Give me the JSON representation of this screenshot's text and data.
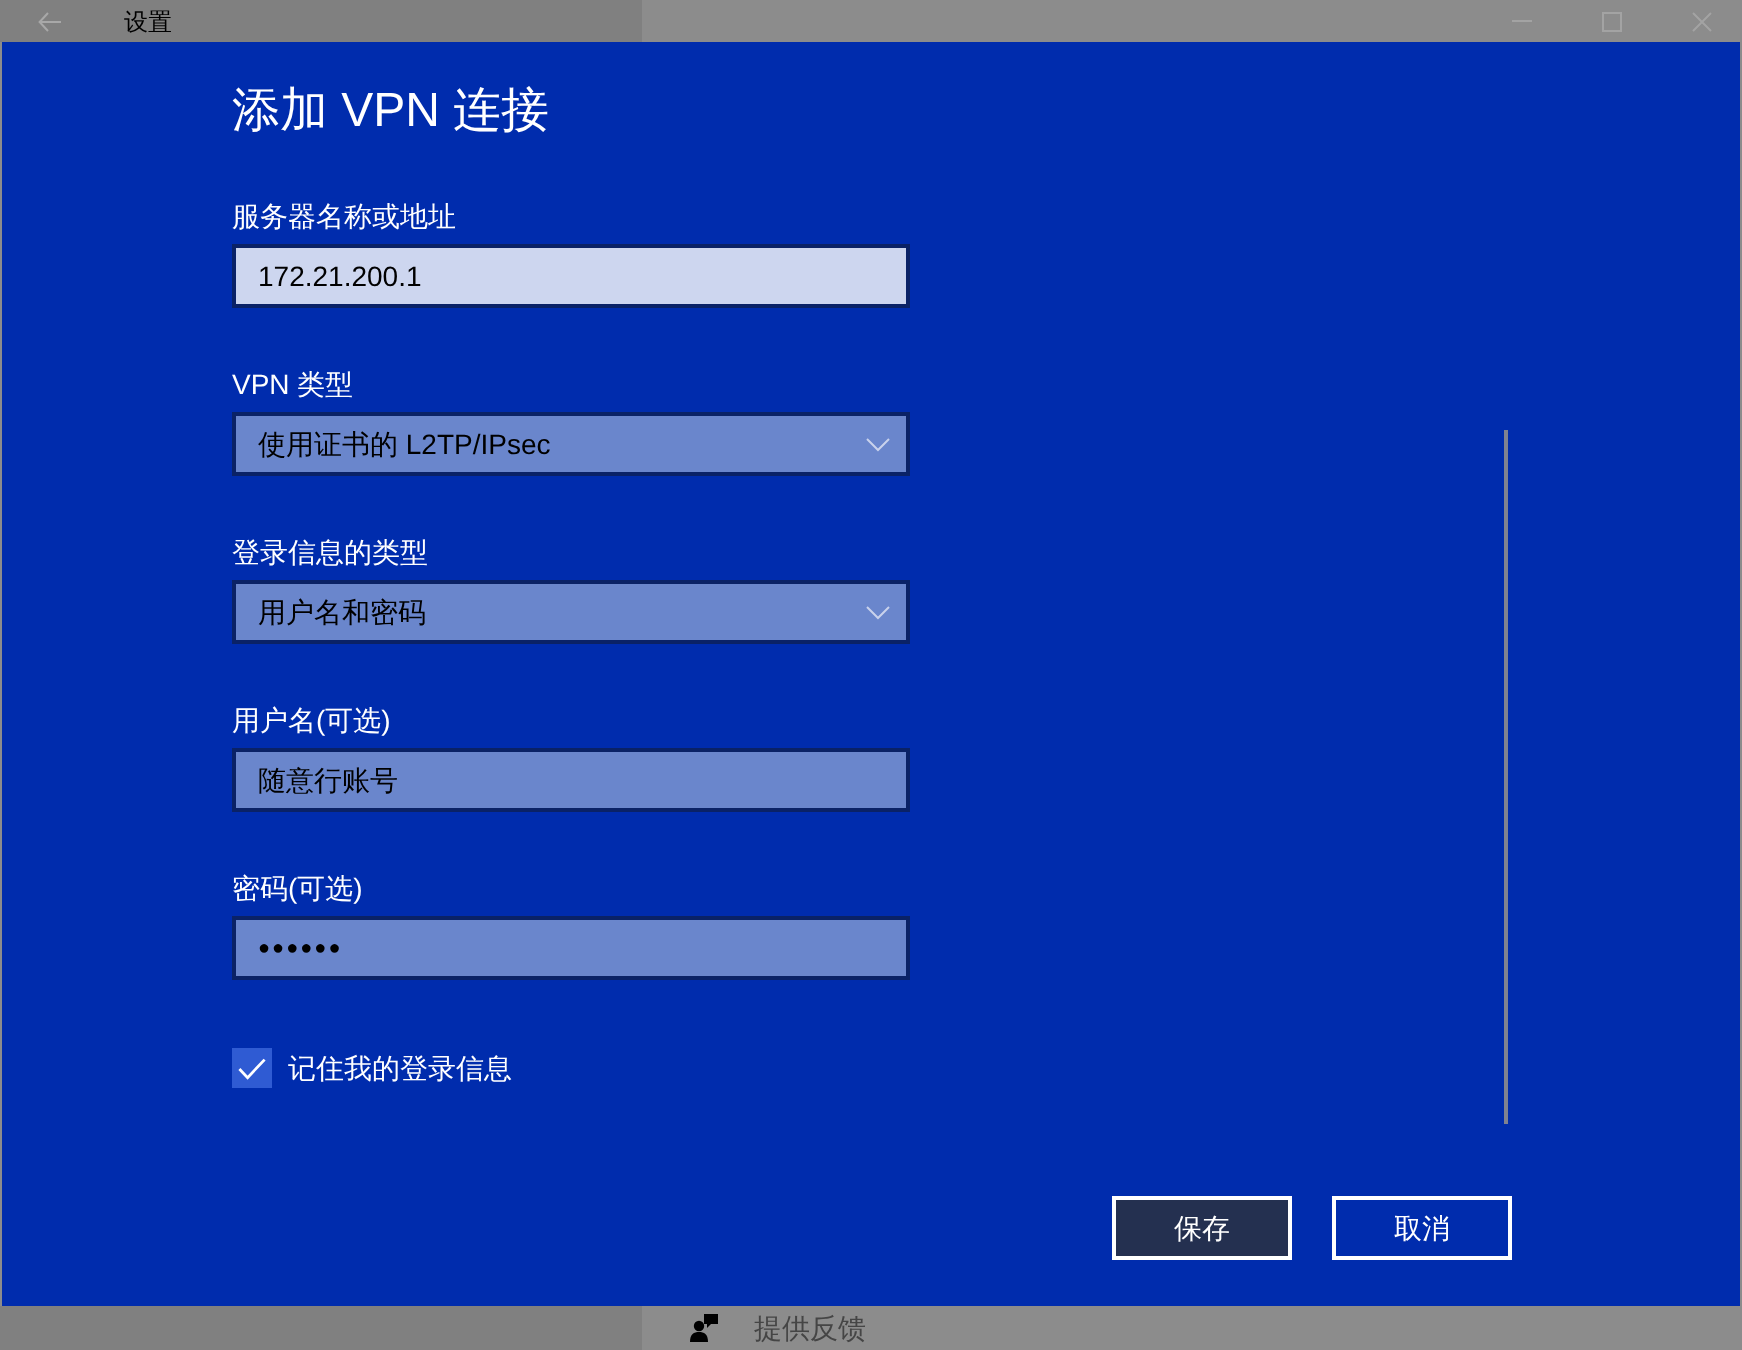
{
  "window": {
    "title": "设置"
  },
  "dialog": {
    "title": "添加 VPN 连接",
    "fields": [
      {
        "kind": "text",
        "label": "服务器名称或地址",
        "value": "172.21.200.1",
        "focused": true
      },
      {
        "kind": "dropdown",
        "label": "VPN 类型",
        "value": "使用证书的 L2TP/IPsec",
        "focused": false
      },
      {
        "kind": "dropdown",
        "label": "登录信息的类型",
        "value": "用户名和密码",
        "focused": false
      },
      {
        "kind": "text",
        "label": "用户名(可选)",
        "value": "随意行账号",
        "focused": false
      },
      {
        "kind": "password",
        "label": "密码(可选)",
        "value": "●●●●●●",
        "focused": false
      }
    ],
    "remember": {
      "label": "记住我的登录信息",
      "checked": true
    },
    "buttons": [
      {
        "label": "保存",
        "default": true
      },
      {
        "label": "取消",
        "default": false
      }
    ]
  },
  "footer": {
    "feedback": "提供反馈"
  }
}
